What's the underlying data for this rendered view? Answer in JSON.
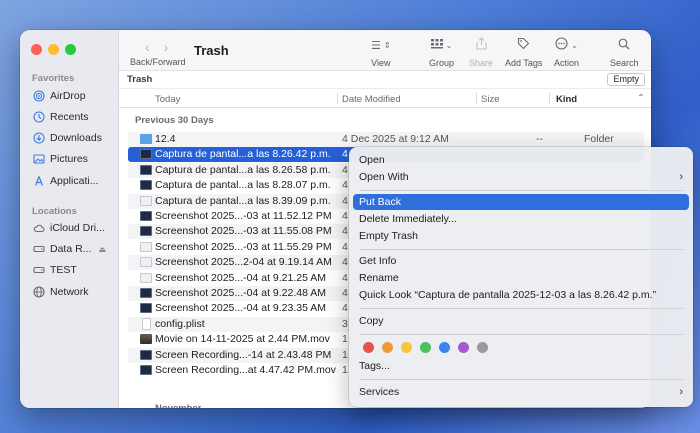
{
  "sidebar": {
    "favorites_label": "Favorites",
    "favorites": [
      {
        "label": "AirDrop",
        "icon": "airdrop-icon"
      },
      {
        "label": "Recents",
        "icon": "clock-icon"
      },
      {
        "label": "Downloads",
        "icon": "download-icon"
      },
      {
        "label": "Pictures",
        "icon": "photo-icon"
      },
      {
        "label": "Applicati...",
        "icon": "applications-icon"
      }
    ],
    "locations_label": "Locations",
    "locations": [
      {
        "label": "iCloud Dri...",
        "icon": "cloud-icon"
      },
      {
        "label": "Data R...",
        "icon": "disk-icon"
      },
      {
        "label": "TEST",
        "icon": "disk-icon"
      },
      {
        "label": "Network",
        "icon": "globe-icon"
      }
    ]
  },
  "toolbar": {
    "title": "Trash",
    "nav_label": "Back/Forward",
    "view_label": "View",
    "group_label": "Group",
    "share_label": "Share",
    "add_tags_label": "Add Tags",
    "action_label": "Action",
    "search_label": "Search"
  },
  "pathbar": {
    "title": "Trash",
    "empty_label": "Empty"
  },
  "columns": {
    "name": "Today",
    "date": "Date Modified",
    "size": "Size",
    "kind": "Kind"
  },
  "groups": {
    "previous30": "Previous 30 Days",
    "november": "November"
  },
  "files": [
    {
      "name": "12.4",
      "date": "4 Dec 2025 at 9:12 AM",
      "size": "--",
      "kind": "Folder",
      "thumb": "folder"
    },
    {
      "name": "Captura de pantal...a las 8.26.42 p.m.",
      "date": "4",
      "size": "",
      "kind": "",
      "thumb": "dark"
    },
    {
      "name": "Captura de pantal...a las 8.26.58 p.m.",
      "date": "4",
      "size": "",
      "kind": "",
      "thumb": "dark"
    },
    {
      "name": "Captura de pantal...a las 8.28.07 p.m.",
      "date": "4",
      "size": "",
      "kind": "",
      "thumb": "dark"
    },
    {
      "name": "Captura de pantal...a las 8.39.09 p.m.",
      "date": "4",
      "size": "",
      "kind": "",
      "thumb": "light"
    },
    {
      "name": "Screenshot 2025...-03 at 11.52.12 PM",
      "date": "4",
      "size": "",
      "kind": "",
      "thumb": "dark"
    },
    {
      "name": "Screenshot 2025...-03 at 11.55.08 PM",
      "date": "4",
      "size": "",
      "kind": "",
      "thumb": "dark"
    },
    {
      "name": "Screenshot 2025...-03 at 11.55.29 PM",
      "date": "4",
      "size": "",
      "kind": "",
      "thumb": "light"
    },
    {
      "name": "Screenshot 2025...2-04 at 9.19.14 AM",
      "date": "4",
      "size": "",
      "kind": "",
      "thumb": "light"
    },
    {
      "name": "Screenshot 2025...-04 at 9.21.25 AM",
      "date": "4",
      "size": "",
      "kind": "",
      "thumb": "light"
    },
    {
      "name": "Screenshot 2025...-04 at 9.22.48 AM",
      "date": "4",
      "size": "",
      "kind": "",
      "thumb": "dark"
    },
    {
      "name": "Screenshot 2025...-04 at 9.23.35 AM",
      "date": "4",
      "size": "",
      "kind": "",
      "thumb": "dark"
    },
    {
      "name": "config.plist",
      "date": "3",
      "size": "",
      "kind": "",
      "thumb": "doc"
    },
    {
      "name": "Movie on 14-11-2025 at 2.44 PM.mov",
      "date": "1",
      "size": "",
      "kind": "",
      "thumb": "mov"
    },
    {
      "name": "Screen Recording...-14 at 2.43.48 PM",
      "date": "1",
      "size": "",
      "kind": "",
      "thumb": "dark"
    },
    {
      "name": "Screen Recording...at 4.47.42 PM.mov",
      "date": "1",
      "size": "",
      "kind": "",
      "thumb": "dark"
    }
  ],
  "context_menu": {
    "open": "Open",
    "open_with": "Open With",
    "put_back": "Put Back",
    "delete_immediately": "Delete Immediately...",
    "empty_trash": "Empty Trash",
    "get_info": "Get Info",
    "rename": "Rename",
    "quick_look": "Quick Look “Captura de pantalla 2025-12-03 a las 8.26.42 p.m.”",
    "copy": "Copy",
    "tags": "Tags...",
    "services": "Services",
    "tag_colors": [
      "#e5534b",
      "#f09a37",
      "#f5c642",
      "#4cc25b",
      "#3f82ee",
      "#a35bd0",
      "#9a9a9e"
    ]
  }
}
